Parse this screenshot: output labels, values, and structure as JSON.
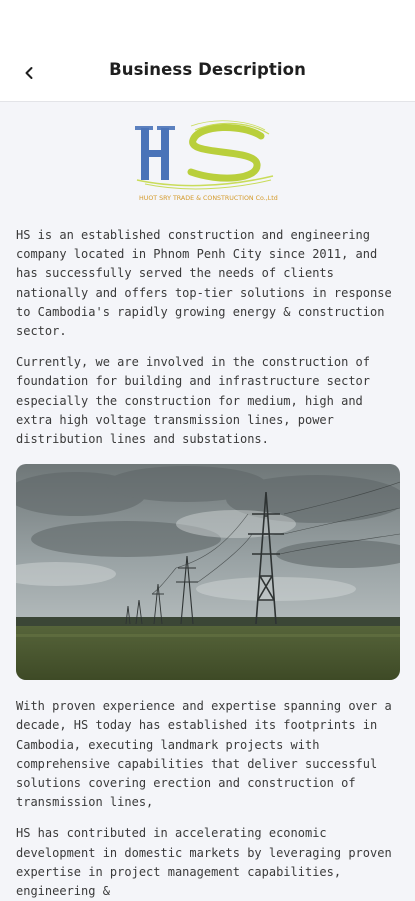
{
  "header": {
    "title": "Business Description",
    "back_icon": "chevron-left-icon"
  },
  "logo": {
    "letters": "HS",
    "tagline": "HUOT SRY TRADE & CONSTRUCTION Co.,Ltd",
    "colors": {
      "h": "#4a73b8",
      "s": "#b9cf3c",
      "tagline": "#d49a2a"
    }
  },
  "paragraphs": [
    "HS is an established construction and engineering company located in Phnom Penh City since 2011, and has successfully served the needs of clients nationally and offers top-tier solutions in response to Cambodia's rapidly growing energy & construction sector.",
    "Currently, we are involved in the construction of foundation for building and infrastructure sector especially the construction for medium, high and extra high voltage transmission lines, power distribution lines and substations.",
    "With proven experience and expertise spanning over a decade, HS today has established its footprints in Cambodia, executing landmark projects with comprehensive capabilities that deliver successful solutions covering erection and construction of transmission lines,",
    "HS has contributed in accelerating economic development in domestic markets by leveraging proven expertise in project management capabilities, engineering &"
  ]
}
